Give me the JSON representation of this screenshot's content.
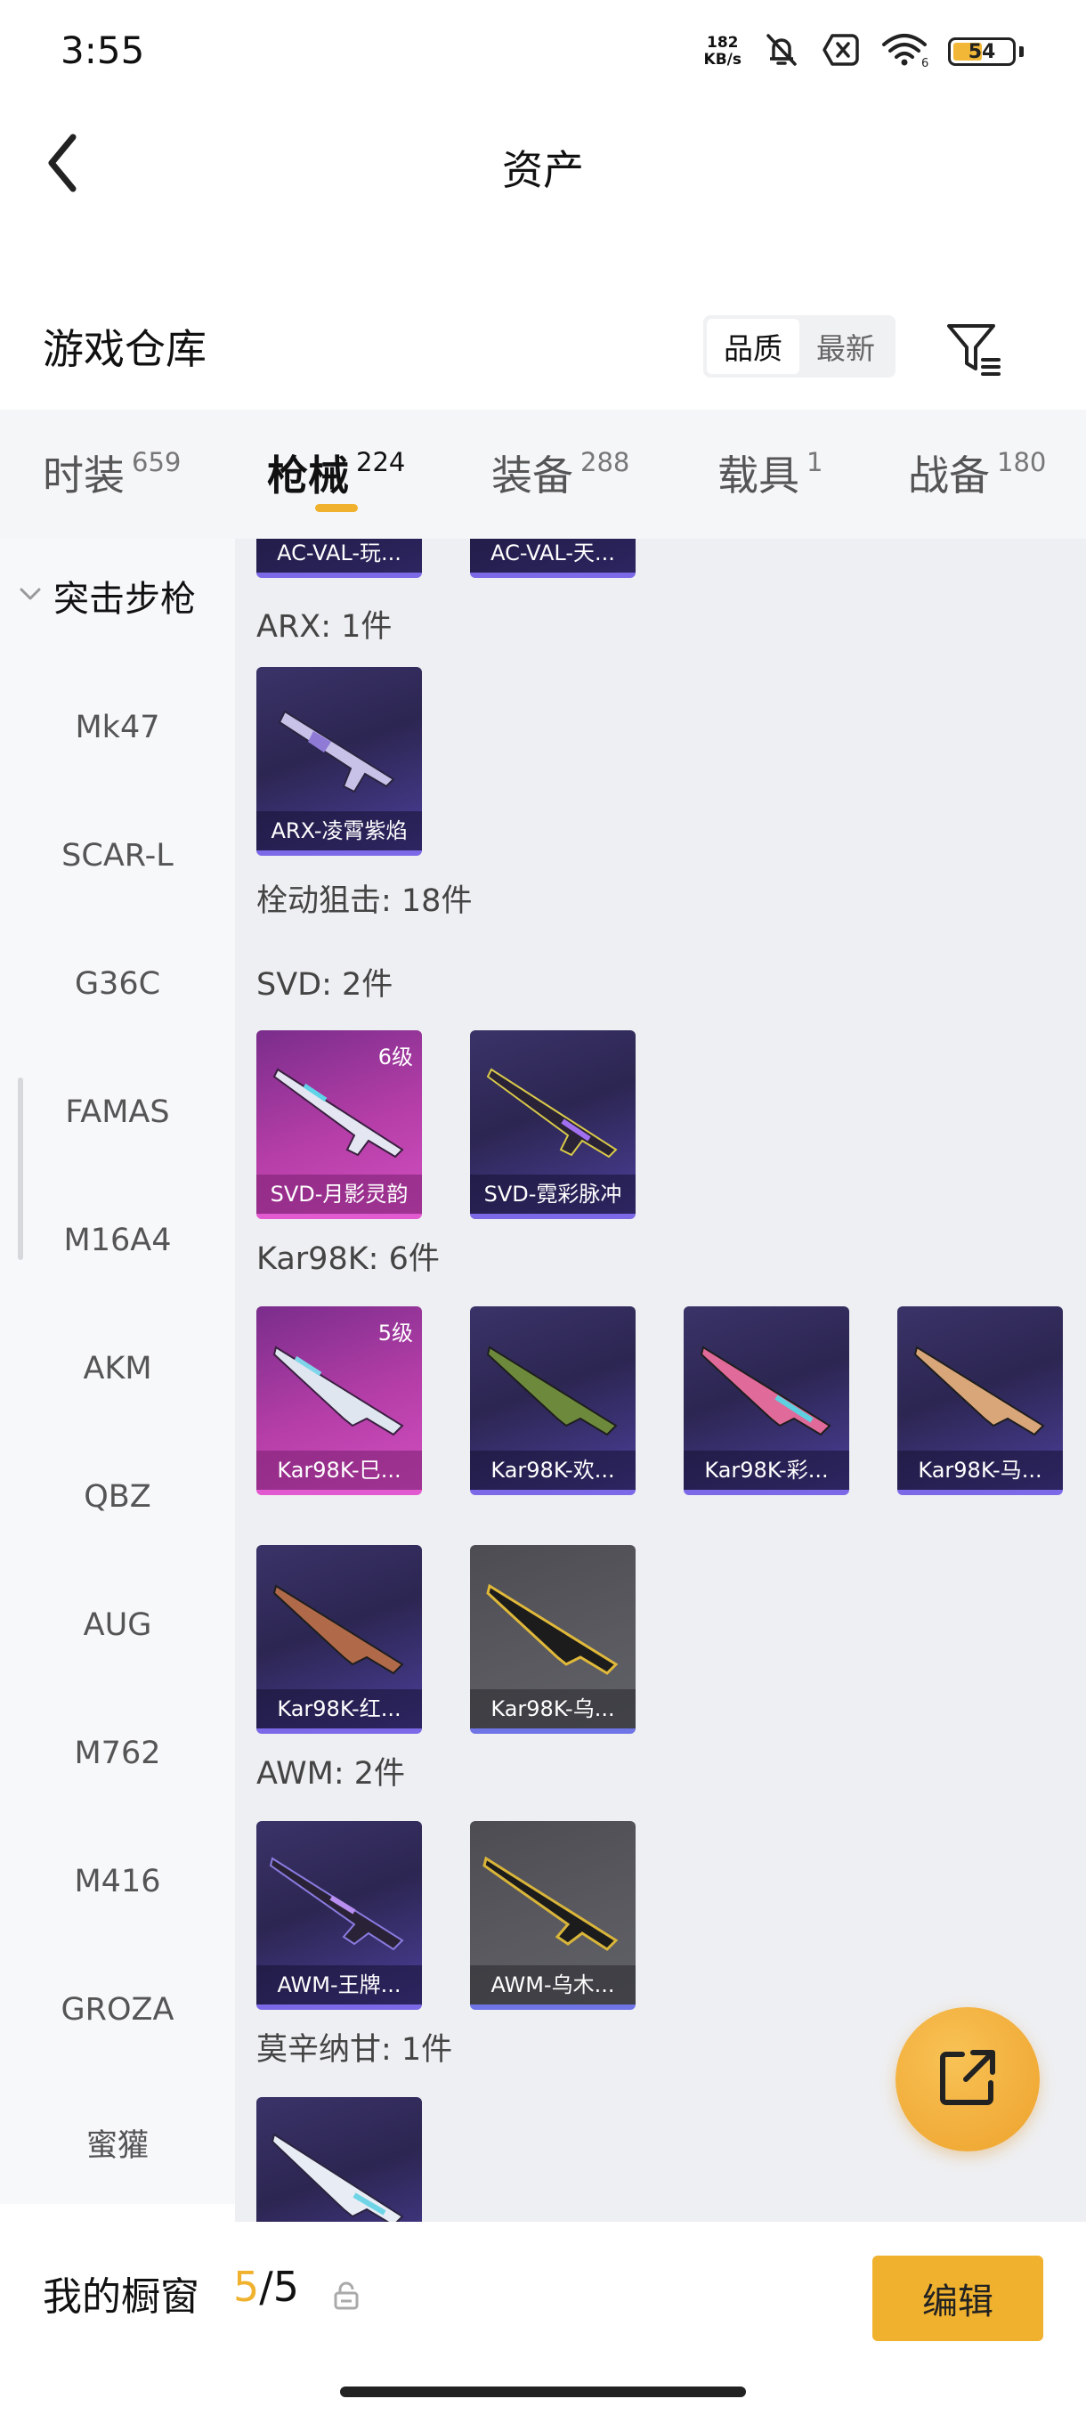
{
  "status_bar": {
    "time": "3:55",
    "net_speed_value": "182",
    "net_speed_unit": "KB/s",
    "battery": "54",
    "battery_level": 0.54,
    "icons": [
      "mute-bell-icon",
      "no-sim-icon",
      "wifi-icon",
      "battery-icon"
    ]
  },
  "nav": {
    "title": "资产",
    "back_icon": "chevron-left-icon"
  },
  "warehouse": {
    "title": "游戏仓库",
    "sort_options": [
      "品质",
      "最新"
    ],
    "sort_selected": "品质",
    "filter_icon": "filter-icon"
  },
  "tabs": [
    {
      "label": "时装",
      "count": "659"
    },
    {
      "label": "枪械",
      "count": "224"
    },
    {
      "label": "装备",
      "count": "288"
    },
    {
      "label": "载具",
      "count": "1"
    },
    {
      "label": "战备",
      "count": "180"
    }
  ],
  "active_tab": "枪械",
  "sidebar": {
    "group_label": "突击步枪",
    "items": [
      "Mk47",
      "SCAR-L",
      "G36C",
      "FAMAS",
      "M16A4",
      "AKM",
      "QBZ",
      "AUG",
      "M762",
      "M416",
      "GROZA",
      "蜜獾"
    ]
  },
  "content": {
    "top_items": [
      {
        "name": "AC-VAL-玩...",
        "rarity": "purple"
      },
      {
        "name": "AC-VAL-天...",
        "rarity": "purple"
      }
    ],
    "arx_label": "ARX: 1件",
    "arx_items": [
      {
        "name": "ARX-凌霄紫焰",
        "rarity": "purple",
        "level": ""
      }
    ],
    "bolt_label": "栓动狙击: 18件",
    "svd_label": "SVD: 2件",
    "svd_items": [
      {
        "name": "SVD-月影灵韵",
        "rarity": "pink",
        "level": "6级"
      },
      {
        "name": "SVD-霓彩脉冲",
        "rarity": "purple",
        "level": ""
      }
    ],
    "kar_label": "Kar98K: 6件",
    "kar_items": [
      {
        "name": "Kar98K-巳...",
        "rarity": "pink",
        "level": "5级"
      },
      {
        "name": "Kar98K-欢...",
        "rarity": "purple",
        "level": ""
      },
      {
        "name": "Kar98K-彩...",
        "rarity": "purple",
        "level": ""
      },
      {
        "name": "Kar98K-马...",
        "rarity": "purple",
        "level": ""
      },
      {
        "name": "Kar98K-红...",
        "rarity": "purple",
        "level": ""
      },
      {
        "name": "Kar98K-乌...",
        "rarity": "gray",
        "level": ""
      }
    ],
    "awm_label": "AWM: 2件",
    "awm_items": [
      {
        "name": "AWM-王牌...",
        "rarity": "purple",
        "level": ""
      },
      {
        "name": "AWM-乌木...",
        "rarity": "gray",
        "level": ""
      }
    ],
    "mosin_label": "莫辛纳甘: 1件"
  },
  "fab_icon": "share-external-icon",
  "bottom": {
    "showcase_label": "我的橱窗",
    "showcase_current": "5",
    "showcase_separator": "/",
    "showcase_total": "5",
    "lock_icon": "lock-icon",
    "edit_label": "编辑"
  },
  "colors": {
    "accent": "#f0b22e",
    "purple_rarity": "#7b69e8",
    "pink_rarity": "#d04fc0",
    "gray_rarity": "#5a5a60"
  }
}
